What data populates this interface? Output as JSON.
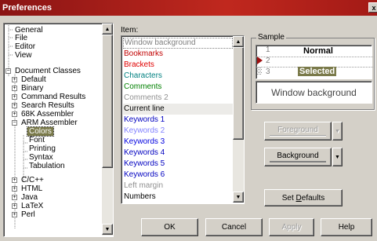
{
  "window": {
    "title": "Preferences",
    "close_glyph": "x"
  },
  "tree": {
    "items": [
      {
        "label": "General"
      },
      {
        "label": "File"
      },
      {
        "label": "Editor"
      },
      {
        "label": "View"
      },
      {
        "label": "Document Classes",
        "expander": "−"
      },
      {
        "label": "Default",
        "expander": "+"
      },
      {
        "label": "Binary",
        "expander": "+"
      },
      {
        "label": "Command Results",
        "expander": "+"
      },
      {
        "label": "Search Results",
        "expander": "+"
      },
      {
        "label": "68K Assembler",
        "expander": "+"
      },
      {
        "label": "ARM Assembler",
        "expander": "−"
      },
      {
        "label": "Colors"
      },
      {
        "label": "Font"
      },
      {
        "label": "Printing"
      },
      {
        "label": "Syntax"
      },
      {
        "label": "Tabulation"
      },
      {
        "label": "C/C++",
        "expander": "+"
      },
      {
        "label": "HTML",
        "expander": "+"
      },
      {
        "label": "Java",
        "expander": "+"
      },
      {
        "label": "LaTeX",
        "expander": "+"
      },
      {
        "label": "Perl",
        "expander": "+"
      }
    ]
  },
  "item_list": {
    "label": "Item:",
    "items": [
      {
        "label": "Window background",
        "color": "#808080"
      },
      {
        "label": "Bookmarks",
        "color": "#c00000"
      },
      {
        "label": "Brackets",
        "color": "#e00000"
      },
      {
        "label": "Characters",
        "color": "#008080"
      },
      {
        "label": "Comments",
        "color": "#008000"
      },
      {
        "label": "Comments 2",
        "color": "#909090"
      },
      {
        "label": "Current line",
        "color": "#000000"
      },
      {
        "label": "Keywords 1",
        "color": "#0000c0"
      },
      {
        "label": "Keywords 2",
        "color": "#8080ff"
      },
      {
        "label": "Keywords 3",
        "color": "#0000e0"
      },
      {
        "label": "Keywords 4",
        "color": "#0000c0"
      },
      {
        "label": "Keywords 5",
        "color": "#0000c0"
      },
      {
        "label": "Keywords 6",
        "color": "#0000c0"
      },
      {
        "label": "Left margin",
        "color": "#909090"
      },
      {
        "label": "Numbers",
        "color": "#000000"
      }
    ]
  },
  "sample": {
    "group_label": "Sample",
    "lines": [
      "1",
      "2",
      "3"
    ],
    "normal_text": "Normal",
    "selected_text": "Selected",
    "window_background_text": "Window background",
    "selected_bg": "#7a7a4a"
  },
  "buttons": {
    "foreground": "Foreground",
    "background": "Background",
    "set_defaults_prefix": "Set ",
    "set_defaults_accel": "D",
    "set_defaults_suffix": "efaults",
    "ok": "OK",
    "cancel": "Cancel",
    "apply": "Apply",
    "help": "Help"
  },
  "colors": {
    "titlebar": "#a31a16",
    "face": "#d4d0c8",
    "selection": "#7a7a4a"
  }
}
